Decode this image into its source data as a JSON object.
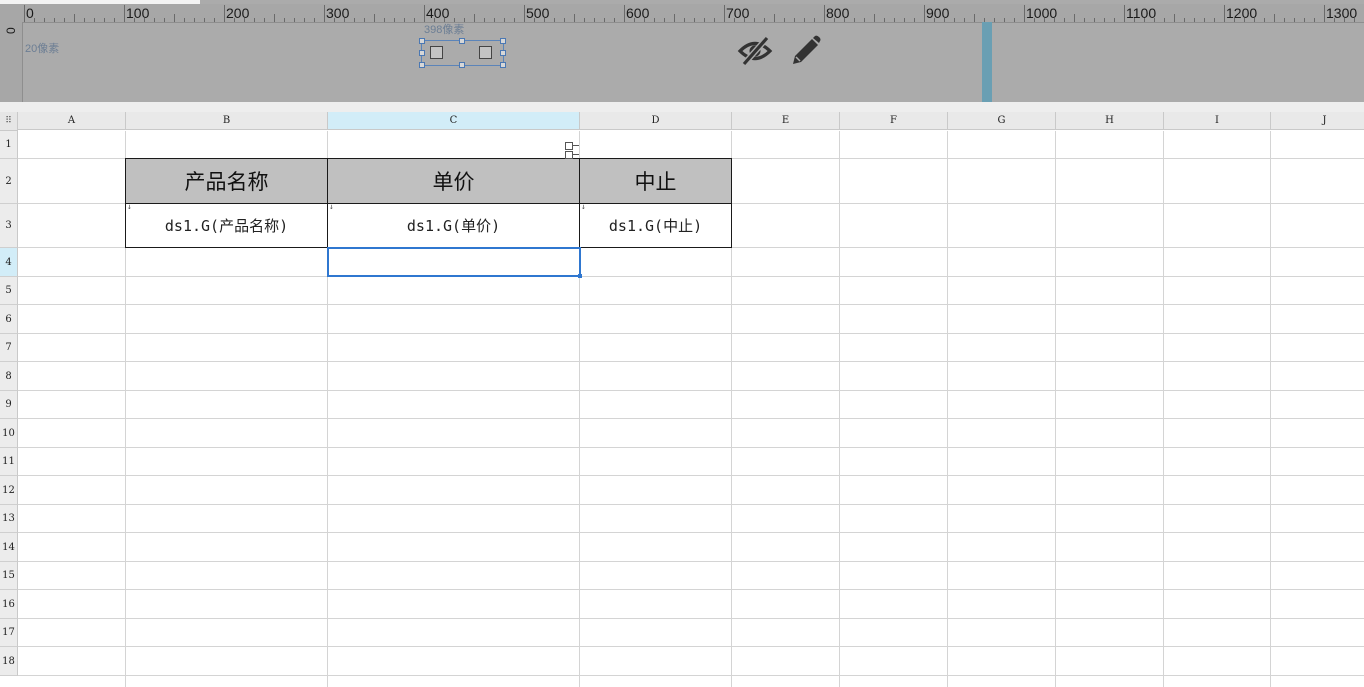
{
  "ruler": {
    "labels": [
      "0",
      "100",
      "200",
      "300",
      "400",
      "500",
      "600",
      "700",
      "800",
      "900",
      "1000",
      "1100",
      "1200",
      "1300"
    ],
    "vertical_label": "0",
    "height_hint": "20像素",
    "width_hint": "398像素"
  },
  "panel": {
    "hide_icon": "eye-slash-icon",
    "edit_icon": "pencil-icon",
    "icon_color": "#333333",
    "divider_color": "#6a9fb3"
  },
  "sheet": {
    "corner": "⠿",
    "columns": [
      "A",
      "B",
      "C",
      "D",
      "E",
      "F",
      "G",
      "H",
      "I",
      "J"
    ],
    "selected_column": "C",
    "rows": [
      "1",
      "2",
      "3",
      "4",
      "5",
      "6",
      "7",
      "8",
      "9",
      "10",
      "11",
      "12",
      "13",
      "14",
      "15",
      "16",
      "17",
      "18"
    ],
    "selected_row": "4",
    "header_cells": {
      "b2": "产品名称",
      "c2": "单价",
      "d2": "中止"
    },
    "data_cells": {
      "b3": "ds1.G(产品名称)",
      "c3": "ds1.G(单价)",
      "d3": "ds1.G(中止)"
    },
    "expand_mark": "↓",
    "selection_color": "#2f77d0",
    "header_fill": "#c0c0c0"
  }
}
